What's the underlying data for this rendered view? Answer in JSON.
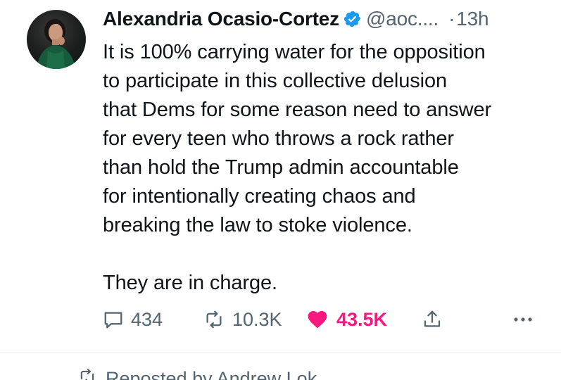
{
  "tweet": {
    "author_name": "Alexandria Ocasio-Cortez",
    "handle": "@aoc....",
    "separator": "·",
    "time": "13h",
    "avatar_icon": "profile-photo",
    "verified_icon": "verified-badge-icon",
    "verified_color": "#1d9bf0",
    "text": "It is 100% carrying water for the opposition\nto participate in this collective delusion\nthat Dems for some reason need to answer\nfor every teen who throws a rock rather\nthan hold the Trump admin accountable\nfor intentionally creating chaos and\nbreaking the law to stoke violence.\n\nThey are in charge."
  },
  "actions": {
    "replies": "434",
    "retweets": "10.3K",
    "likes": "43.5K",
    "liked": true,
    "like_color": "#f91880",
    "muted_color": "#536471"
  },
  "next": {
    "reposted_text": "Reposted by Andrew Lok"
  }
}
